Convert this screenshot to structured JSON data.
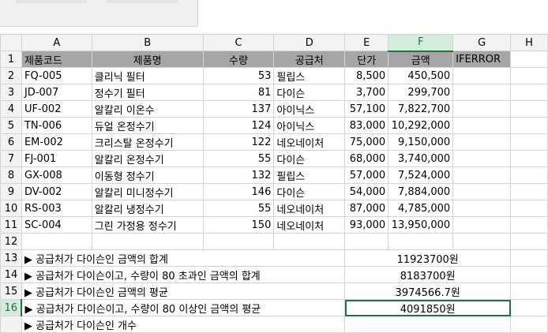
{
  "columns": [
    "A",
    "B",
    "C",
    "D",
    "E",
    "F",
    "G",
    "H"
  ],
  "row_numbers": [
    "1",
    "2",
    "3",
    "4",
    "5",
    "6",
    "7",
    "8",
    "9",
    "10",
    "11",
    "12",
    "13",
    "14",
    "15",
    "16",
    ""
  ],
  "header": [
    "제품코드",
    "제품명",
    "수량",
    "공급처",
    "단가",
    "금액",
    "IFERROR"
  ],
  "rows": [
    [
      "FQ-005",
      "클리닉 필터",
      "53",
      "필립스",
      "8,500",
      "450,500"
    ],
    [
      "JD-007",
      "정수기 필터",
      "81",
      "다이슨",
      "3,700",
      "299,700"
    ],
    [
      "UF-002",
      "알칼리 이온수",
      "137",
      "아이닉스",
      "57,100",
      "7,822,700"
    ],
    [
      "TN-006",
      "듀얼 온정수기",
      "124",
      "아이닉스",
      "83,000",
      "10,292,000"
    ],
    [
      "EM-002",
      "크리스탈 온정수기",
      "122",
      "네오네이처",
      "75,000",
      "9,150,000"
    ],
    [
      "FJ-001",
      "알칼리 온정수기",
      "55",
      "다이슨",
      "68,000",
      "3,740,000"
    ],
    [
      "GX-008",
      "이동형 정수기",
      "132",
      "필립스",
      "57,000",
      "7,524,000"
    ],
    [
      "DV-002",
      "알칼리 미니정수기",
      "146",
      "다이슨",
      "54,000",
      "7,884,000"
    ],
    [
      "RS-003",
      "알칼리 냉정수기",
      "55",
      "네오네이처",
      "87,000",
      "4,785,000"
    ],
    [
      "SC-004",
      "그린 가정용 정수기",
      "150",
      "네오네이처",
      "93,000",
      "13,950,000"
    ]
  ],
  "summary": [
    {
      "label": "▶ 공급처가 다이슨인 금액의 합계",
      "value": "11923700원"
    },
    {
      "label": "▶ 공급처가 다이슨이고, 수량이 80 초과인 금액의 합계",
      "value": "8183700원"
    },
    {
      "label": "▶ 공급처가 다이슨인 금액의 평균",
      "value": "3974566.7원"
    },
    {
      "label": "▶ 공급처가 다이슨이고, 수량이 80 이상인 금액의 평균",
      "value": "4091850원"
    },
    {
      "label": "▶ 공급처가 다이슨인 개수",
      "value": ""
    }
  ],
  "selected_cell": "F16"
}
